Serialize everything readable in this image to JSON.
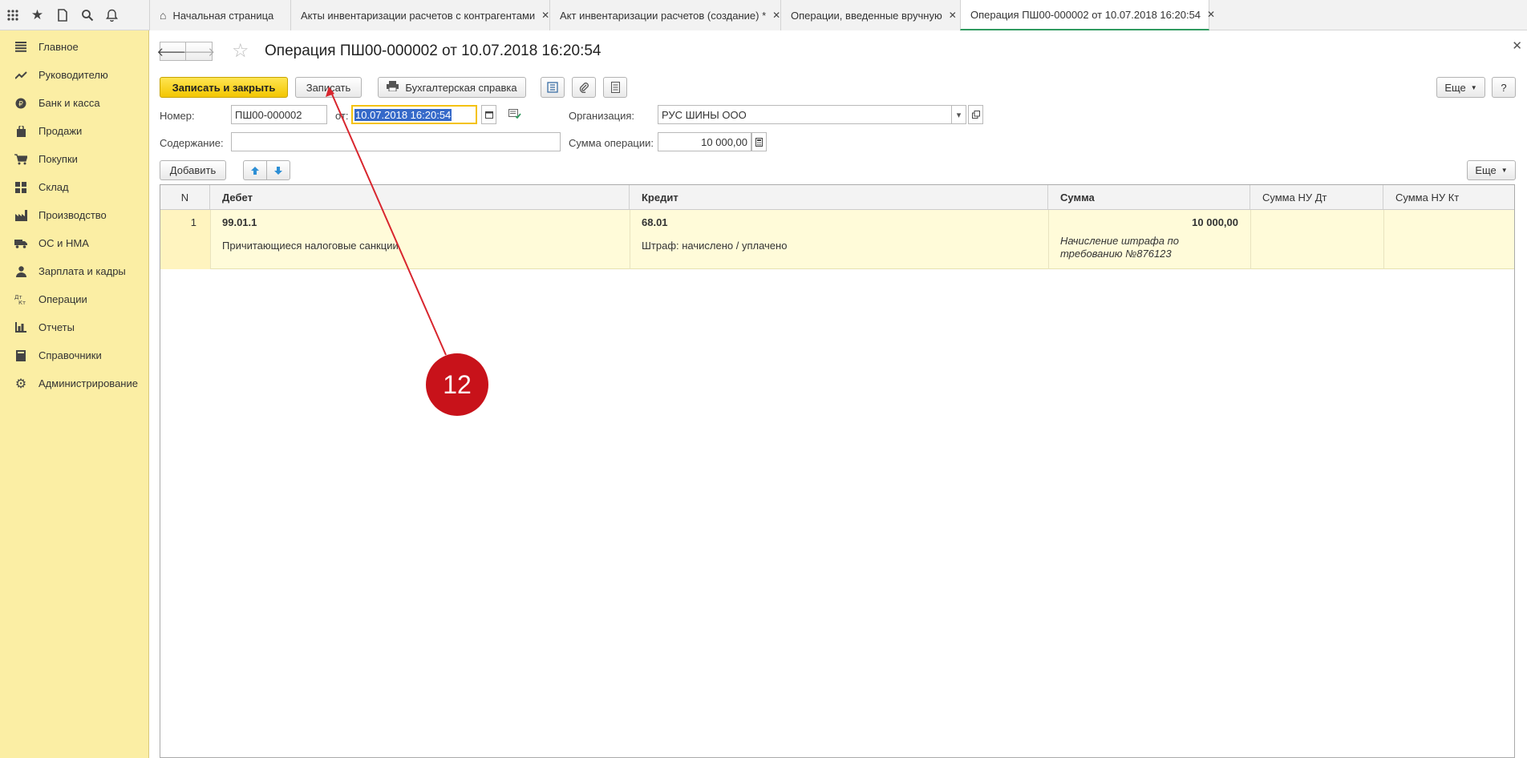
{
  "tabs": [
    {
      "label": "Начальная страница",
      "closable": false,
      "active": false
    },
    {
      "label": "Акты инвентаризации расчетов с контрагентами",
      "closable": true,
      "active": false
    },
    {
      "label": "Акт инвентаризации расчетов (создание) *",
      "closable": true,
      "active": false
    },
    {
      "label": "Операции, введенные вручную",
      "closable": true,
      "active": false
    },
    {
      "label": "Операция ПШ00-000002 от 10.07.2018 16:20:54",
      "closable": true,
      "active": true
    }
  ],
  "sidebar": {
    "items": [
      {
        "label": "Главное",
        "icon": "menu-lines-icon"
      },
      {
        "label": "Руководителю",
        "icon": "trend-icon"
      },
      {
        "label": "Банк и касса",
        "icon": "ruble-coin-icon"
      },
      {
        "label": "Продажи",
        "icon": "shopping-bag-icon"
      },
      {
        "label": "Покупки",
        "icon": "cart-icon"
      },
      {
        "label": "Склад",
        "icon": "warehouse-grid-icon"
      },
      {
        "label": "Производство",
        "icon": "factory-icon"
      },
      {
        "label": "ОС и НМА",
        "icon": "truck-icon"
      },
      {
        "label": "Зарплата и кадры",
        "icon": "person-icon"
      },
      {
        "label": "Операции",
        "icon": "dt-kt-icon"
      },
      {
        "label": "Отчеты",
        "icon": "bar-chart-icon"
      },
      {
        "label": "Справочники",
        "icon": "book-icon"
      },
      {
        "label": "Администрирование",
        "icon": "gear-icon"
      }
    ]
  },
  "document": {
    "title": "Операция ПШ00-000002 от 10.07.2018 16:20:54"
  },
  "toolbar": {
    "save_close_label": "Записать и закрыть",
    "save_label": "Записать",
    "accounting_report_label": "Бухгалтерская справка",
    "more_label": "Еще",
    "help_label": "?"
  },
  "form": {
    "number_label": "Номер:",
    "number_value": "ПШ00-000002",
    "date_label": "от:",
    "date_value": "10.07.2018 16:20:54",
    "org_label": "Организация:",
    "org_value": "РУС ШИНЫ ООО",
    "content_label": "Содержание:",
    "content_value": "",
    "sum_label": "Сумма операции:",
    "sum_value": "10 000,00"
  },
  "table_toolbar": {
    "add_label": "Добавить",
    "more_label": "Еще"
  },
  "table": {
    "columns": [
      "N",
      "Дебет",
      "Кредит",
      "Сумма",
      "Сумма НУ Дт",
      "Сумма НУ Кт"
    ],
    "rows": [
      {
        "n": "1",
        "debit": "99.01.1",
        "debit_sub": "Причитающиеся налоговые санкции",
        "credit": "68.01",
        "credit_sub": "Штраф: начислено / уплачено",
        "sum": "10 000,00",
        "sum_note_1": "Начисление штрафа по",
        "sum_note_2": "требованию №876123",
        "sum_nu_dt": "",
        "sum_nu_kt": ""
      }
    ]
  },
  "annotation": {
    "label": "12",
    "color": "#c8121a"
  }
}
